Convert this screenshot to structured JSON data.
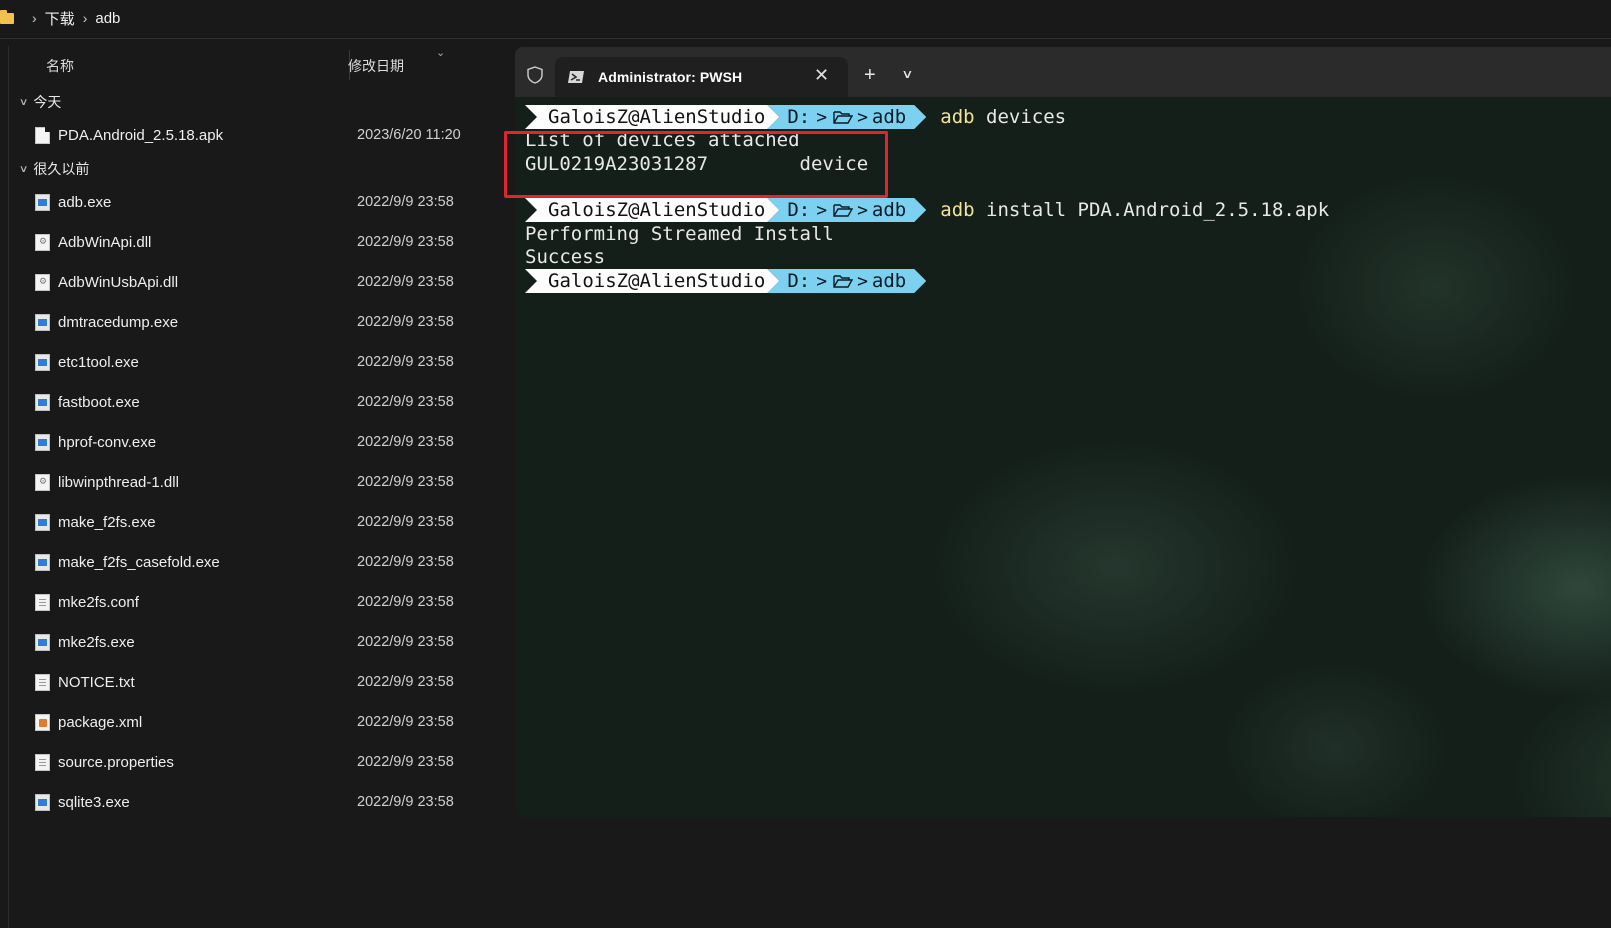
{
  "breadcrumb": {
    "sep1": "›",
    "part1": "下载",
    "sep2": "›",
    "part2": "adb"
  },
  "explorer": {
    "columns": {
      "name": "名称",
      "date": "修改日期"
    },
    "groups": [
      {
        "label": "今天",
        "files": [
          {
            "name": "PDA.Android_2.5.18.apk",
            "date": "2023/6/20 11:20",
            "icon": "apk"
          }
        ]
      },
      {
        "label": "很久以前",
        "files": [
          {
            "name": "adb.exe",
            "date": "2022/9/9 23:58",
            "icon": "exe"
          },
          {
            "name": "AdbWinApi.dll",
            "date": "2022/9/9 23:58",
            "icon": "dll"
          },
          {
            "name": "AdbWinUsbApi.dll",
            "date": "2022/9/9 23:58",
            "icon": "dll"
          },
          {
            "name": "dmtracedump.exe",
            "date": "2022/9/9 23:58",
            "icon": "exe"
          },
          {
            "name": "etc1tool.exe",
            "date": "2022/9/9 23:58",
            "icon": "exe"
          },
          {
            "name": "fastboot.exe",
            "date": "2022/9/9 23:58",
            "icon": "exe"
          },
          {
            "name": "hprof-conv.exe",
            "date": "2022/9/9 23:58",
            "icon": "exe"
          },
          {
            "name": "libwinpthread-1.dll",
            "date": "2022/9/9 23:58",
            "icon": "dll"
          },
          {
            "name": "make_f2fs.exe",
            "date": "2022/9/9 23:58",
            "icon": "exe"
          },
          {
            "name": "make_f2fs_casefold.exe",
            "date": "2022/9/9 23:58",
            "icon": "exe"
          },
          {
            "name": "mke2fs.conf",
            "date": "2022/9/9 23:58",
            "icon": "doc"
          },
          {
            "name": "mke2fs.exe",
            "date": "2022/9/9 23:58",
            "icon": "exe"
          },
          {
            "name": "NOTICE.txt",
            "date": "2022/9/9 23:58",
            "icon": "doc"
          },
          {
            "name": "package.xml",
            "date": "2022/9/9 23:58",
            "icon": "xml"
          },
          {
            "name": "source.properties",
            "date": "2022/9/9 23:58",
            "icon": "doc"
          },
          {
            "name": "sqlite3.exe",
            "date": "2022/9/9 23:58",
            "icon": "exe"
          }
        ]
      }
    ]
  },
  "terminal": {
    "tab_title": "Administrator: PWSH",
    "prompt": {
      "user": "GaloisZ@AlienStudio",
      "drive": "D:",
      "sep": ">",
      "dir": "adb"
    },
    "commands": {
      "c1_kw": "adb",
      "c1_rest": " devices",
      "c2_kw": "adb",
      "c2_rest": " install PDA.Android_2.5.18.apk"
    },
    "output": {
      "list_header": "List of devices attached",
      "device_line": "GUL0219A23031287        device",
      "install_1": "Performing Streamed Install",
      "install_2": "Success"
    }
  },
  "colors": {
    "prompt_user_bg": "#fdfdfd",
    "prompt_path_bg": "#7cd0f0",
    "command_keyword": "#f2e39a",
    "highlight_box": "#e0262a"
  }
}
